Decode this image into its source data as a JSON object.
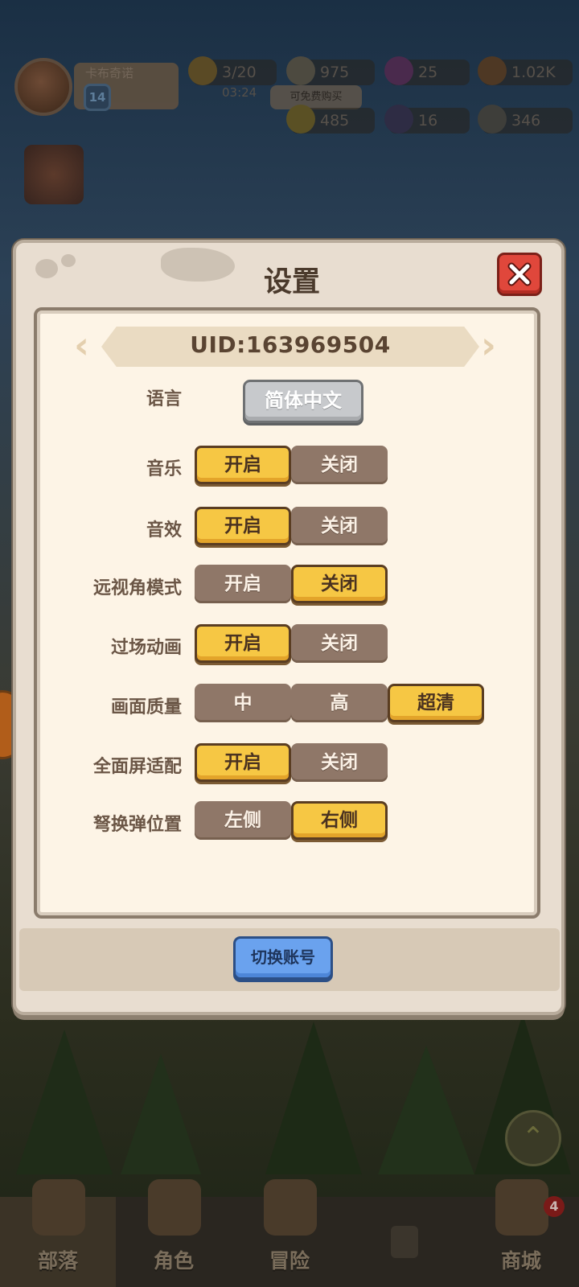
{
  "hud": {
    "player_name": "卡布奇诺",
    "level": "14",
    "energy": "3/20",
    "energy_timer": "03:24",
    "gems": "975",
    "buy_tag": "可免费购买",
    "keys": "25",
    "wood": "1.02K",
    "gold": "485",
    "crystals": "16",
    "stone": "346"
  },
  "dialog": {
    "title": "设置",
    "uid": "UID:163969504",
    "language": {
      "label": "语言",
      "value": "简体中文"
    },
    "settings": [
      {
        "label": "音乐",
        "options": [
          "开启",
          "关闭"
        ],
        "selected": 0
      },
      {
        "label": "音效",
        "options": [
          "开启",
          "关闭"
        ],
        "selected": 0
      },
      {
        "label": "远视角模式",
        "options": [
          "开启",
          "关闭"
        ],
        "selected": 1
      },
      {
        "label": "过场动画",
        "options": [
          "开启",
          "关闭"
        ],
        "selected": 0
      },
      {
        "label": "画面质量",
        "options": [
          "中",
          "高",
          "超清"
        ],
        "selected": 2
      },
      {
        "label": "全面屏适配",
        "options": [
          "开启",
          "关闭"
        ],
        "selected": 0
      },
      {
        "label": "弩换弹位置",
        "options": [
          "左侧",
          "右侧"
        ],
        "selected": 1
      }
    ],
    "switch_account": "切换账号"
  },
  "bottom_nav": {
    "items": [
      {
        "label": "部落"
      },
      {
        "label": "角色"
      },
      {
        "label": "冒险"
      },
      {
        "label": ""
      },
      {
        "label": "商城"
      }
    ],
    "shop_badge": "4"
  },
  "colors": {
    "toggle_on": "#f6c744",
    "toggle_off": "#8f7768",
    "close_button": "#e0473b",
    "switch_button": "#6aa2ee"
  }
}
